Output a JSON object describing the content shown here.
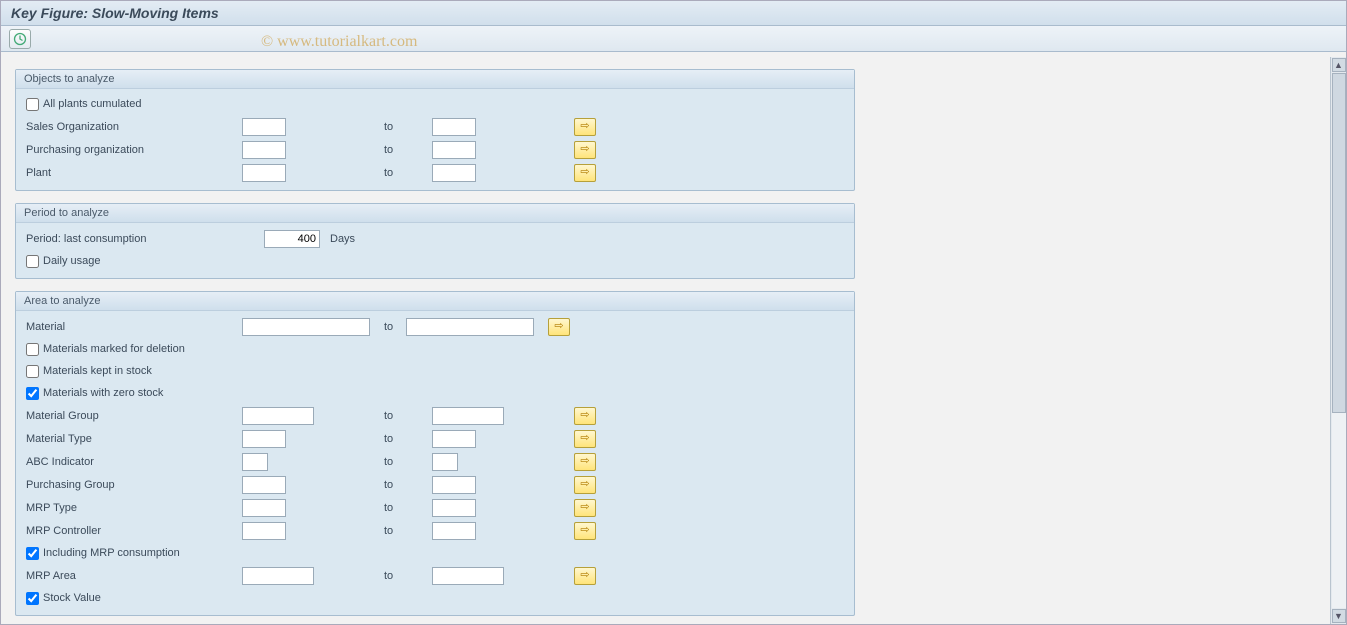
{
  "window": {
    "title": "Key Figure: Slow-Moving Items"
  },
  "watermark": "© www.tutorialkart.com",
  "toolbar": {
    "execute_tooltip": "Execute"
  },
  "common": {
    "to_label": "to"
  },
  "group_objects": {
    "title": "Objects to analyze",
    "all_plants_cumulated": "All plants cumulated",
    "sales_org": "Sales Organization",
    "purch_org": "Purchasing organization",
    "plant": "Plant"
  },
  "group_period": {
    "title": "Period to analyze",
    "period_last_consumption": "Period: last consumption",
    "period_value": "400",
    "unit_days": "Days",
    "daily_usage": "Daily usage"
  },
  "group_area": {
    "title": "Area to analyze",
    "material": "Material",
    "materials_marked_deletion": "Materials marked for deletion",
    "materials_kept_stock": "Materials kept in stock",
    "materials_zero_stock": "Materials with zero stock",
    "material_group": "Material Group",
    "material_type": "Material Type",
    "abc_indicator": "ABC Indicator",
    "purchasing_group": "Purchasing Group",
    "mrp_type": "MRP Type",
    "mrp_controller": "MRP Controller",
    "including_mrp_consumption": "Including MRP consumption",
    "mrp_area": "MRP Area",
    "stock_value": "Stock Value"
  }
}
